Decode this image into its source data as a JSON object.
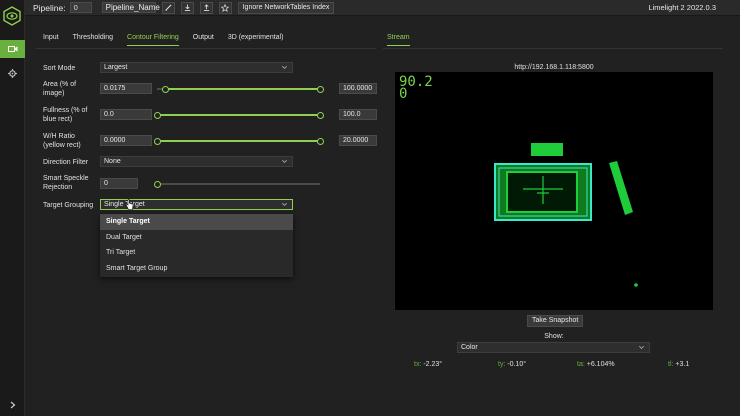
{
  "topbar": {
    "pipeline_label": "Pipeline:",
    "pipeline_index": "0",
    "pipeline_name": "Pipeline_Name",
    "ignore_nt_button": "Ignore NetworkTables Index",
    "version": "Limelight 2 2022.0.3"
  },
  "tabs": [
    "Input",
    "Thresholding",
    "Contour Filtering",
    "Output",
    "3D (experimental)"
  ],
  "active_tab": "Contour Filtering",
  "stream_tab": "Stream",
  "form": {
    "sort_mode": {
      "label": "Sort Mode",
      "value": "Largest"
    },
    "area": {
      "label_line1": "Area (% of",
      "label_line2": "image)",
      "min": "0.0175",
      "max": "100.0000",
      "min_fraction": 0.05,
      "max_fraction": 1.0
    },
    "fullness": {
      "label_line1": "Fullness (% of",
      "label_line2": "blue rect)",
      "min": "0.0",
      "max": "100.0",
      "min_fraction": 0.0,
      "max_fraction": 1.0
    },
    "wh_ratio": {
      "label_line1": "W/H Ratio",
      "label_line2": "(yellow rect)",
      "min": "0.0000",
      "max": "20.0000",
      "min_fraction": 0.0,
      "max_fraction": 1.0
    },
    "direction_filter": {
      "label": "Direction Filter",
      "value": "None"
    },
    "speckle": {
      "label_line1": "Smart Speckle",
      "label_line2": "Rejection",
      "value": "0",
      "fraction": 0.0
    },
    "target_grouping": {
      "label": "Target Grouping",
      "value": "Single Target",
      "options": [
        "Single Target",
        "Dual Target",
        "Tri Target",
        "Smart Target Group"
      ]
    }
  },
  "stream": {
    "url": "http://192.168.1.118:5800",
    "fps_overlay": "90.2",
    "overlay_line2": "0",
    "snapshot_button": "Take Snapshot",
    "show_label": "Show:",
    "show_value": "Color",
    "readouts": [
      {
        "key": "tx:",
        "value": "-2.23°"
      },
      {
        "key": "ty:",
        "value": "-0.10°"
      },
      {
        "key": "ta:",
        "value": "+6.104%"
      },
      {
        "key": "tl:",
        "value": "+3.1"
      }
    ]
  },
  "colors": {
    "accent": "#8fd14f",
    "sidebar_active": "#6ab03f",
    "target_green": "#1fcc3a",
    "target_cyan": "#39e8c8"
  }
}
